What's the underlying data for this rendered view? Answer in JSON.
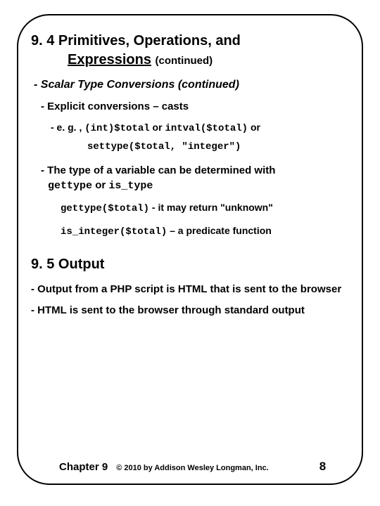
{
  "heading": {
    "section": "9. 4",
    "title_line1": "Primitives, Operations, and",
    "title_line2_underlined": "Expressions",
    "continued": "(continued)"
  },
  "sub_heading": "- Scalar Type Conversions (continued)",
  "explicit": "- Explicit conversions – casts",
  "eg_prefix": "- e. g. ,",
  "eg_code1": "(int)$total",
  "eg_or1": "or",
  "eg_code2": "intval($total)",
  "eg_or2": "or",
  "eg_code3": "settype($total, \"integer\")",
  "typedet_prefix": "- The type of a variable can be determined with",
  "typedet_code1": "gettype",
  "typedet_mid": "or",
  "typedet_code2": "is_type",
  "line_gettype_code": "gettype($total)",
  "line_gettype_text": " - it may return \"unknown\"",
  "line_isint_code": "is_integer($total)",
  "line_isint_text": " – a predicate function",
  "output_heading": "9. 5 Output",
  "out_bullet1": "- Output from a PHP script is HTML that is sent to the browser",
  "out_bullet2": "- HTML is sent to the browser through standard output",
  "footer": {
    "chapter": "Chapter 9",
    "copyright": "© 2010 by Addison Wesley Longman, Inc.",
    "page": "8"
  }
}
